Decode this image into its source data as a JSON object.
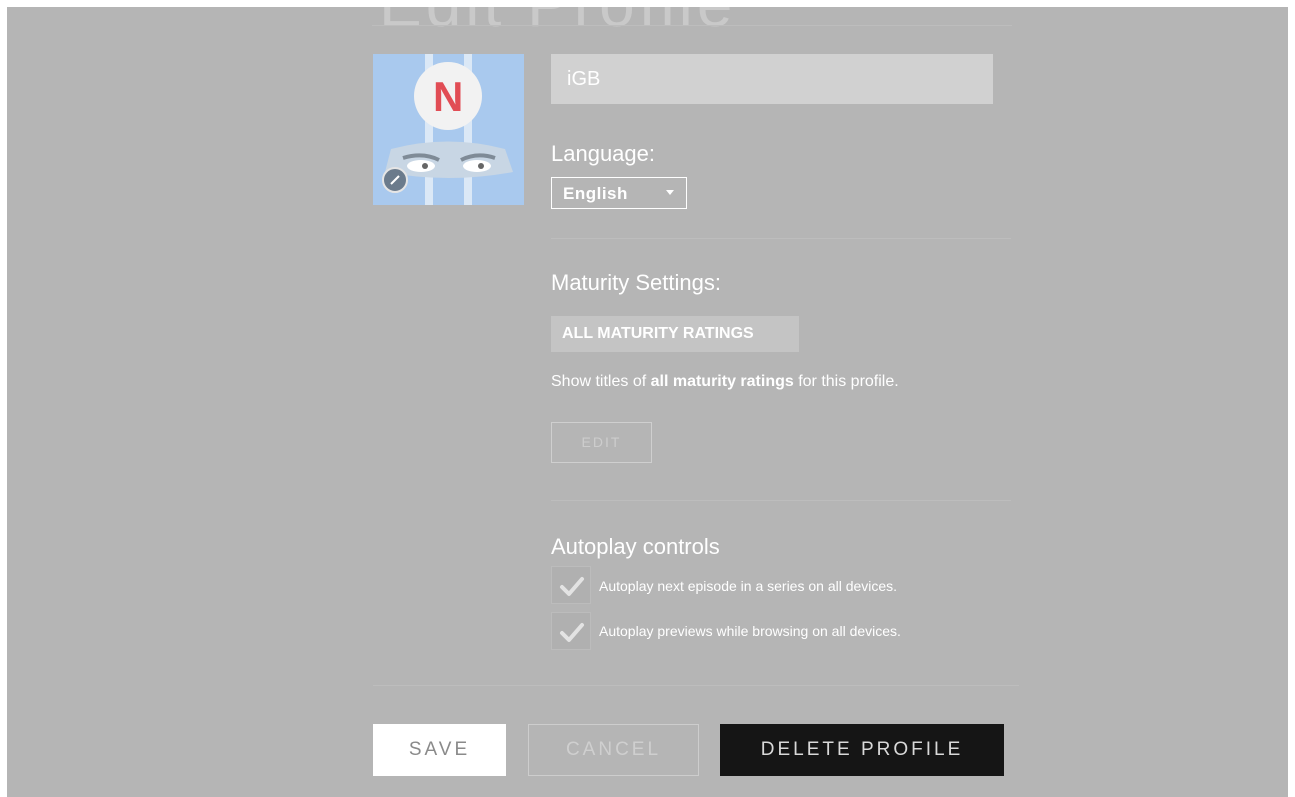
{
  "header": {
    "title_fragment": "Edit Profile"
  },
  "profile": {
    "name_value": "iGB",
    "avatar_letter": "N",
    "language_label": "Language:",
    "language_value": "English"
  },
  "maturity": {
    "heading": "Maturity Settings:",
    "badge": "ALL MATURITY RATINGS",
    "desc_prefix": "Show titles of ",
    "desc_bold": "all maturity ratings",
    "desc_suffix": " for this profile.",
    "edit_label": "EDIT"
  },
  "autoplay": {
    "heading": "Autoplay controls",
    "options": [
      {
        "label": "Autoplay next episode in a series on all devices.",
        "checked": true
      },
      {
        "label": "Autoplay previews while browsing on all devices.",
        "checked": true
      }
    ]
  },
  "actions": {
    "save_label": "SAVE",
    "cancel_label": "CANCEL",
    "delete_label": "DELETE PROFILE"
  },
  "colors": {
    "overlay": "#b5b5b5",
    "avatar_bg": "#a9c9ee",
    "logo_red": "#e14d55",
    "delete_bg": "#151515"
  }
}
